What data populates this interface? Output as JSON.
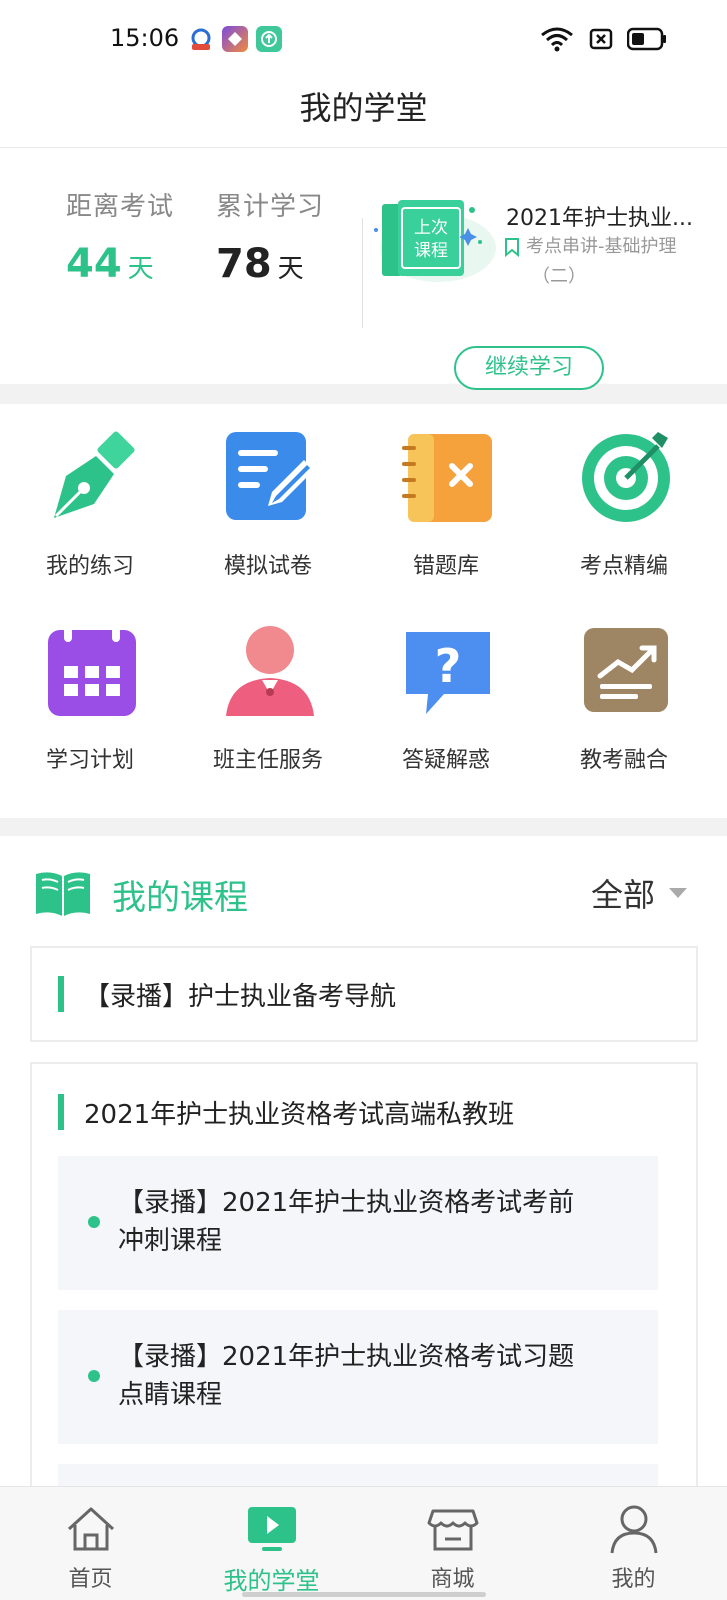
{
  "status_bar": {
    "time": "15:06"
  },
  "header": {
    "title": "我的学堂"
  },
  "stats": {
    "exam_countdown": {
      "label": "距离考试",
      "value": "44",
      "unit": "天"
    },
    "total_study": {
      "label": "累计学习",
      "value": "78",
      "unit": "天"
    }
  },
  "last_course": {
    "badge_line1": "上次",
    "badge_line2": "课程",
    "title": "2021年护士执业...",
    "subtitle_line1": "考点串讲-基础护理",
    "subtitle_line2": "（二）",
    "continue_label": "继续学习"
  },
  "tools": [
    {
      "label": "我的练习",
      "icon": "pen-nib-icon"
    },
    {
      "label": "模拟试卷",
      "icon": "document-edit-icon"
    },
    {
      "label": "错题库",
      "icon": "error-notebook-icon"
    },
    {
      "label": "考点精编",
      "icon": "target-icon"
    },
    {
      "label": "学习计划",
      "icon": "calendar-icon"
    },
    {
      "label": "班主任服务",
      "icon": "teacher-icon"
    },
    {
      "label": "答疑解惑",
      "icon": "question-bubble-icon"
    },
    {
      "label": "教考融合",
      "icon": "trend-chart-icon"
    }
  ],
  "courses": {
    "title": "我的课程",
    "filter_label": "全部",
    "items": [
      {
        "title": "【录播】护士执业备考导航"
      },
      {
        "title": "2021年护士执业资格考试高端私教班",
        "sub_items": [
          {
            "line1": "【录播】2021年护士执业资格考试考前",
            "line2": "冲刺课程"
          },
          {
            "line1": "【录播】2021年护士执业资格考试习题",
            "line2": "点睛课程"
          }
        ]
      }
    ]
  },
  "tab_bar": {
    "tabs": [
      {
        "label": "首页",
        "icon": "home-icon"
      },
      {
        "label": "我的学堂",
        "icon": "play-icon"
      },
      {
        "label": "商城",
        "icon": "store-icon"
      },
      {
        "label": "我的",
        "icon": "person-icon"
      }
    ],
    "active_index": 1
  },
  "colors": {
    "accent": "#2ec28b"
  }
}
